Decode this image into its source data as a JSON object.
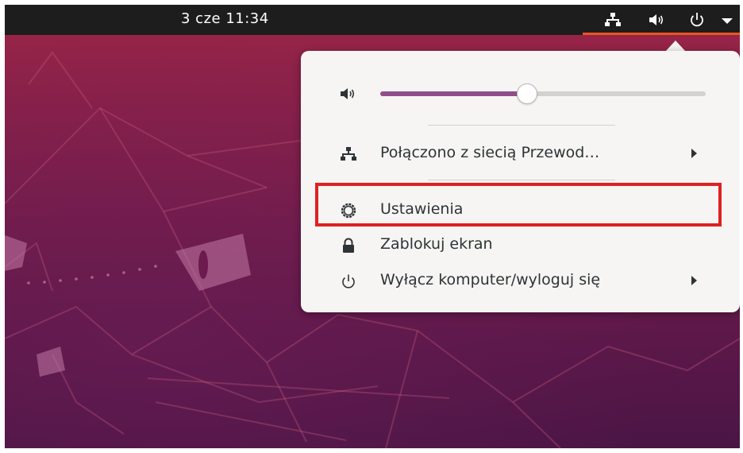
{
  "topbar": {
    "clock": "3 cze  11:34",
    "icons": [
      "network-wired-icon",
      "volume-icon",
      "power-icon",
      "dropdown-arrow-icon"
    ]
  },
  "system_menu": {
    "volume": {
      "icon": "volume-icon",
      "level_percent": 45
    },
    "items": [
      {
        "icon": "network-wired-icon",
        "label": "Połączono z siecią Przewod…",
        "has_submenu": true
      },
      {
        "icon": "settings-icon",
        "label": "Ustawienia",
        "has_submenu": false,
        "highlighted": true
      },
      {
        "icon": "lock-icon",
        "label": "Zablokuj ekran",
        "has_submenu": false
      },
      {
        "icon": "power-icon",
        "label": "Wyłącz komputer/wyloguj się",
        "has_submenu": true
      }
    ]
  },
  "colors": {
    "accent": "#e95420",
    "slider_fill": "#924d8b",
    "highlight_box": "#e02020",
    "menu_bg": "#f6f5f4",
    "topbar_bg": "#1d1d1d"
  }
}
